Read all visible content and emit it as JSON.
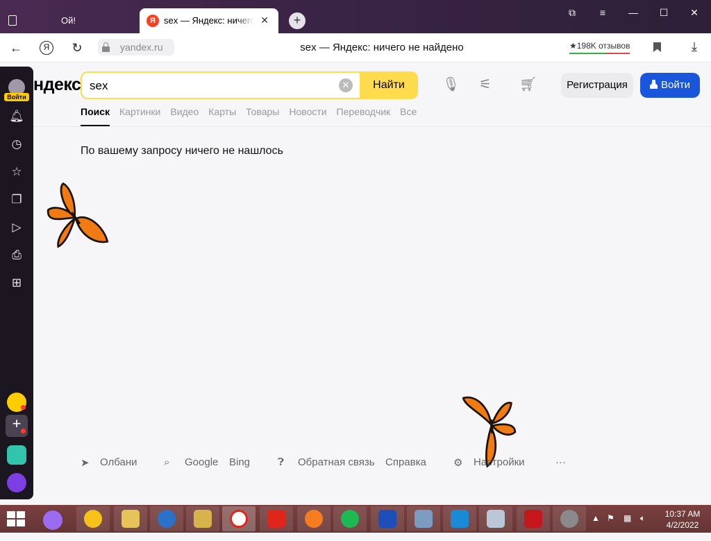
{
  "browser": {
    "tabs": [
      {
        "title": "Ой!"
      },
      {
        "title": "sex — Яндекс: ничего не найдено",
        "favicon": "Я"
      }
    ],
    "url": "yandex.ru",
    "page_title": "sex — Яндекс: ничего не найдено",
    "reviews": "★198K отзывов",
    "sidebar": {
      "login_badge": "Войти"
    }
  },
  "search": {
    "logo": "ндекс",
    "query": "sex",
    "find_label": "Найти",
    "register_label": "Регистрация",
    "login_label": "Войти",
    "tabs": [
      "Поиск",
      "Картинки",
      "Видео",
      "Карты",
      "Товары",
      "Новости",
      "Переводчик",
      "Все"
    ],
    "no_results": "По вашему запросу ничего не нашлось"
  },
  "footer": {
    "location": "Олбани",
    "google": "Google",
    "bing": "Bing",
    "feedback": "Обратная связь",
    "help": "Справка",
    "settings": "Настройки",
    "more": "···"
  },
  "taskbar": {
    "time": "10:37 AM",
    "date": "4/2/2022"
  },
  "colors": {
    "accent_yellow": "#ffdb4d",
    "login_blue": "#1a56db",
    "butterfly_orange": "#f07a13"
  }
}
